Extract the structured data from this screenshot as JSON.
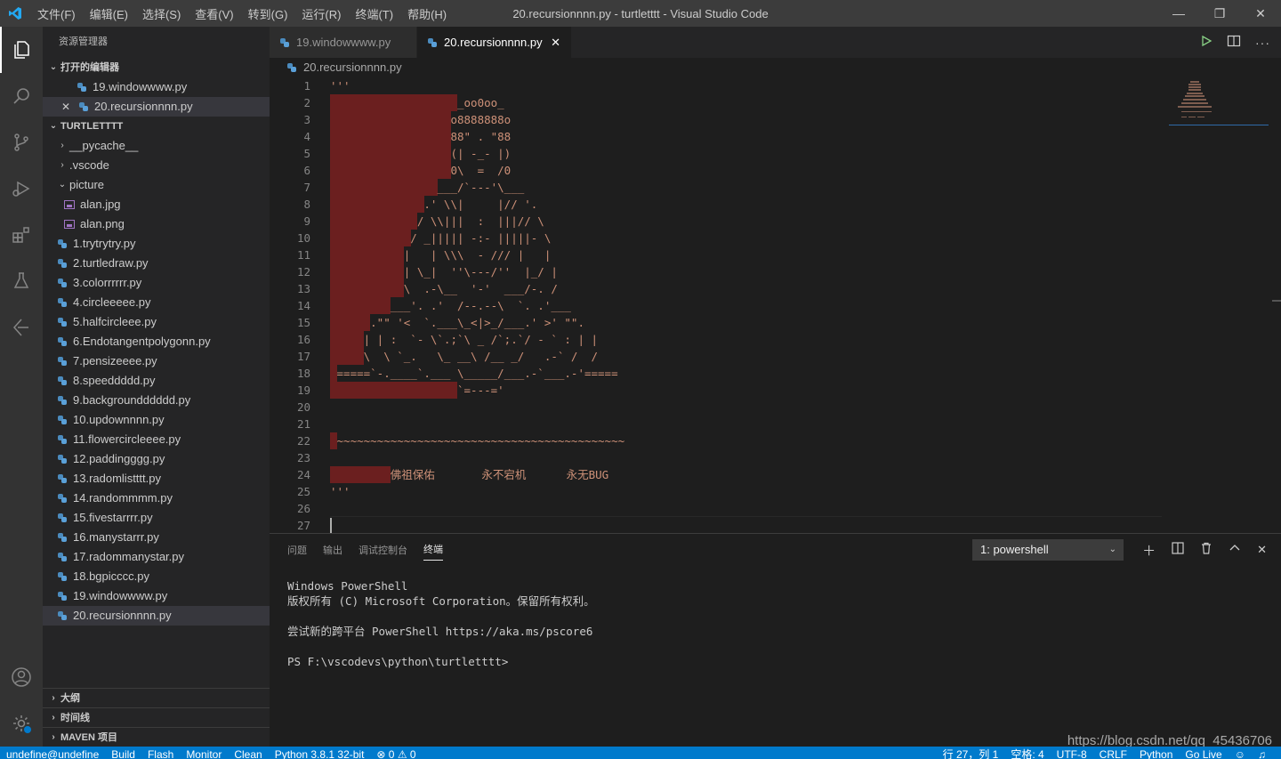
{
  "titlebar": {
    "menus": [
      "文件(F)",
      "编辑(E)",
      "选择(S)",
      "查看(V)",
      "转到(G)",
      "运行(R)",
      "终端(T)",
      "帮助(H)"
    ],
    "title": "20.recursionnnn.py - turtletttt - Visual Studio Code"
  },
  "sidebar": {
    "title": "资源管理器",
    "open_editors_label": "打开的编辑器",
    "open_editors": [
      "19.windowwww.py",
      "20.recursionnnn.py"
    ],
    "folder_label": "TURTLETTTT",
    "folders": [
      "__pycache__",
      ".vscode",
      "picture"
    ],
    "picture_files": [
      "alan.jpg",
      "alan.png"
    ],
    "files": [
      "1.trytrytry.py",
      "2.turtledraw.py",
      "3.colorrrrrr.py",
      "4.circleeeee.py",
      "5.halfcircleee.py",
      "6.Endotangentpolygonn.py",
      "7.pensizeeee.py",
      "8.speeddddd.py",
      "9.backgroundddddd.py",
      "10.updownnnn.py",
      "11.flowercircleeee.py",
      "12.paddingggg.py",
      "13.radomlistttt.py",
      "14.randommmm.py",
      "15.fivestarrrr.py",
      "16.manystarrr.py",
      "17.radommanystar.py",
      "18.bgpicccc.py",
      "19.windowwww.py",
      "20.recursionnnn.py"
    ],
    "outline_label": "大纲",
    "timeline_label": "时间线",
    "maven_label": "MAVEN 项目"
  },
  "tabs": [
    {
      "label": "19.windowwww.py"
    },
    {
      "label": "20.recursionnnn.py"
    }
  ],
  "breadcrumb": "20.recursionnnn.py",
  "editor": {
    "lines": [
      "'''",
      "                   _oo0oo_",
      "                  o8888888o",
      "                  88\" . \"88",
      "                  (| -_- |)",
      "                  0\\  =  /0",
      "                ___/`---'\\___",
      "              .' \\\\|     |// '.",
      "             / \\\\|||  :  |||// \\",
      "            / _||||| -:- |||||- \\",
      "           |   | \\\\\\  - /// |   |",
      "           | \\_|  ''\\---/''  |_/ |",
      "           \\  .-\\__  '-'  ___/-. /",
      "         ___'. .'  /--.--\\  `. .'___",
      "      .\"\" '<  `.___\\_<|>_/___.' >' \"\".",
      "     | | :  `- \\`.;`\\ _ /`;.`/ - ` : | |",
      "     \\  \\ `_.   \\_ __\\ /__ _/   .-` /  /",
      " =====`-.____`.___ \\_____/___.-`___.-'=====",
      "                   `=---='",
      "",
      "",
      " ~~~~~~~~~~~~~~~~~~~~~~~~~~~~~~~~~~~~~~~~~~~",
      "",
      "         佛祖保佑       永不宕机      永无BUG",
      "'''",
      "",
      ""
    ]
  },
  "panel": {
    "tabs": [
      "问题",
      "输出",
      "调试控制台",
      "终端"
    ],
    "terminal_select": "1: powershell",
    "terminal_lines": [
      "Windows PowerShell",
      "版权所有 (C) Microsoft Corporation。保留所有权利。",
      "",
      "尝试新的跨平台 PowerShell https://aka.ms/pscore6",
      "",
      "PS F:\\vscodevs\\python\\turtletttt>"
    ]
  },
  "watermark": "https://blog.csdn.net/qq_45436706",
  "statusbar": {
    "left": [
      "undefine@undefine",
      "Build",
      "Flash",
      "Monitor",
      "Clean",
      "Python 3.8.1 32-bit",
      "⊗ 0 ⚠ 0"
    ],
    "right": [
      "行 27，列 1",
      "空格: 4",
      "UTF-8",
      "CRLF",
      "Python",
      "Go Live"
    ]
  },
  "colors": {
    "statusbar": "#007acc",
    "string": "#ce9178",
    "indent_highlight": "#6b1f1f"
  }
}
